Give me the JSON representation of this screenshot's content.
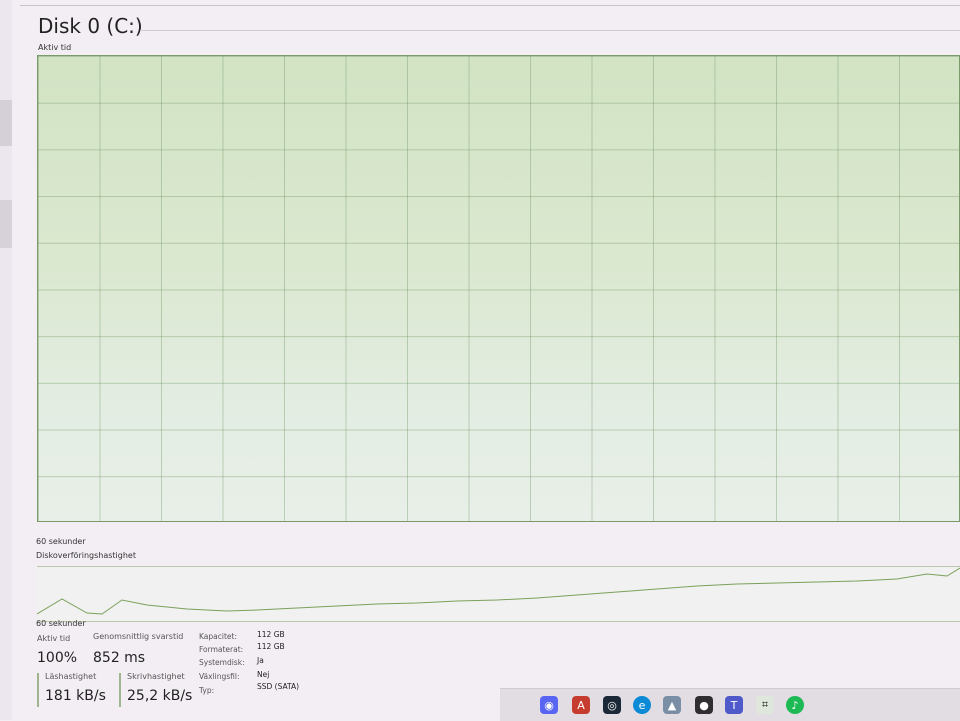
{
  "window": {
    "title": "Disk 0 (C:)"
  },
  "graph_active": {
    "label": "Aktiv tid",
    "time_label": "60 sekunder"
  },
  "graph_transfer": {
    "label": "Diskoverföringshastighet",
    "time_label": "60 sekunder"
  },
  "stats": {
    "active_time_label": "Aktiv tid",
    "active_time_value": "100%",
    "response_label": "Genomsnittlig svarstid",
    "response_value": "852 ms",
    "read_label": "Läshastighet",
    "read_value": "181 kB/s",
    "write_label": "Skrivhastighet",
    "write_value": "25,2 kB/s"
  },
  "properties": [
    {
      "label": "Kapacitet:",
      "value": "112 GB"
    },
    {
      "label": "Formaterat:",
      "value": "112 GB"
    },
    {
      "label": "Systemdisk:",
      "value": "Ja"
    },
    {
      "label": "Växlingsfil:",
      "value": "Nej"
    },
    {
      "label": "Typ:",
      "value": "SSD (SATA)"
    }
  ],
  "taskbar_icons": [
    {
      "name": "discord-icon",
      "color": "#5865f2"
    },
    {
      "name": "autocad-icon",
      "color": "#c63d2f"
    },
    {
      "name": "steam-icon",
      "color": "#1b2838"
    },
    {
      "name": "edge-icon",
      "color": "#0c8ad6"
    },
    {
      "name": "photos-icon",
      "color": "#7a8fa6"
    },
    {
      "name": "obs-icon",
      "color": "#302e31"
    },
    {
      "name": "teams-icon",
      "color": "#5059c9"
    },
    {
      "name": "task-manager-icon",
      "color": "#2f7d4f"
    },
    {
      "name": "spotify-icon",
      "color": "#1db954"
    }
  ],
  "accent_color": "#7ba05b"
}
